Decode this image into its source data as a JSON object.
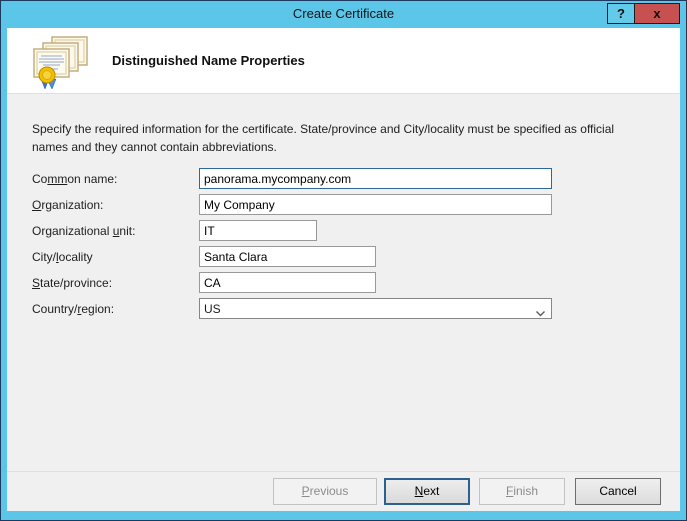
{
  "window": {
    "title": "Create Certificate",
    "help_button_label": "?",
    "close_button_label": "x"
  },
  "header": {
    "title": "Distinguished Name Properties",
    "icon": "certificates-icon"
  },
  "instructions": "Specify the required information for the certificate. State/province and City/locality must be specified as official names and they cannot contain abbreviations.",
  "fields": {
    "common_name": {
      "label_pre": "Co",
      "label_accel": "mm",
      "label_post": "on name:",
      "value": "panorama.mycompany.com"
    },
    "organization": {
      "label_pre": "",
      "label_accel": "O",
      "label_post": "rganization:",
      "value": "My Company"
    },
    "organizational_unit": {
      "label_pre": "Organizational ",
      "label_accel": "u",
      "label_post": "nit:",
      "value": "IT"
    },
    "city_locality": {
      "label_pre": "City/",
      "label_accel": "l",
      "label_post": "ocality",
      "value": "Santa Clara"
    },
    "state_province": {
      "label_pre": "",
      "label_accel": "S",
      "label_post": "tate/province:",
      "value": "CA"
    },
    "country_region": {
      "label_pre": "Country/",
      "label_accel": "r",
      "label_post": "egion:",
      "value": "US"
    }
  },
  "buttons": {
    "previous": {
      "accel": "P",
      "rest": "revious",
      "state": "disabled"
    },
    "next": {
      "accel": "N",
      "rest": "ext",
      "state": "default"
    },
    "finish": {
      "accel": "F",
      "rest": "inish",
      "state": "disabled"
    },
    "cancel": {
      "accel": "",
      "rest": "Cancel",
      "state": "normal"
    }
  },
  "icons": {
    "chevron": "chevron-down-icon",
    "certificates": "certificates-icon"
  },
  "colors": {
    "titlebar_blue": "#5CC6E8",
    "frame_navy": "#1B3A5E",
    "close_red": "#C75050",
    "focus_blue": "#2B618E",
    "body_gray": "#F0F0F0",
    "header_white": "#FFFFFF"
  }
}
